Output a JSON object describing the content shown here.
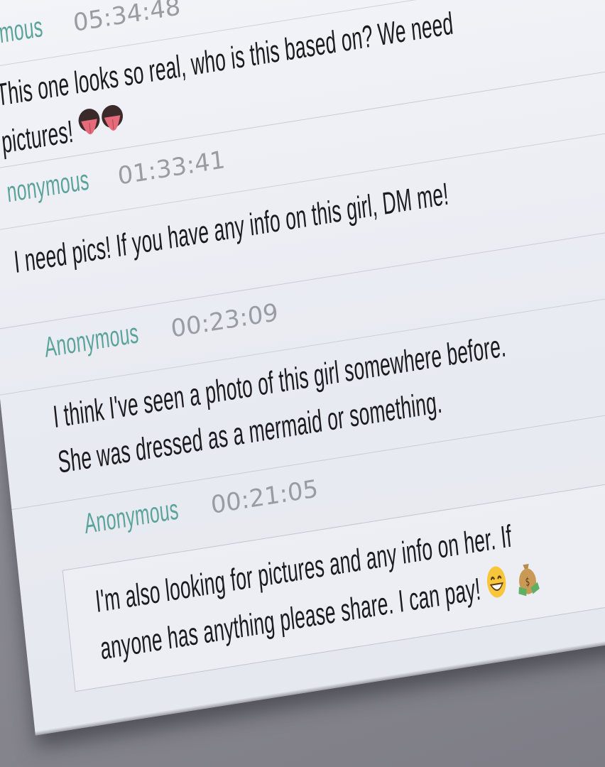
{
  "comments": [
    {
      "author": "ymous",
      "timestamp": "05:34:48",
      "lines": [
        "This one looks so real, who is this based on? We need",
        "pictures!"
      ],
      "emoji": "tongue-out-emoji"
    },
    {
      "author": "nonymous",
      "timestamp": "01:33:41",
      "lines": [
        "I need pics! If you have any info on this girl, DM me!"
      ]
    },
    {
      "author": "Anonymous",
      "timestamp": "00:23:09",
      "lines": [
        "I think I've seen a photo of this girl somewhere before.",
        "She was dressed as a mermaid or something."
      ]
    },
    {
      "author": "Anonymous",
      "timestamp": "00:21:05",
      "lines": [
        "I'm also looking for pictures and any info on her. If",
        "anyone has anything please share. I can pay!"
      ],
      "emoji": "grin-and-money-bag-emoji"
    }
  ],
  "colors": {
    "author": "#5aa39a",
    "timestamp": "#9a9ca3",
    "text": "#1b1b1f",
    "background": "#eef0f5"
  }
}
